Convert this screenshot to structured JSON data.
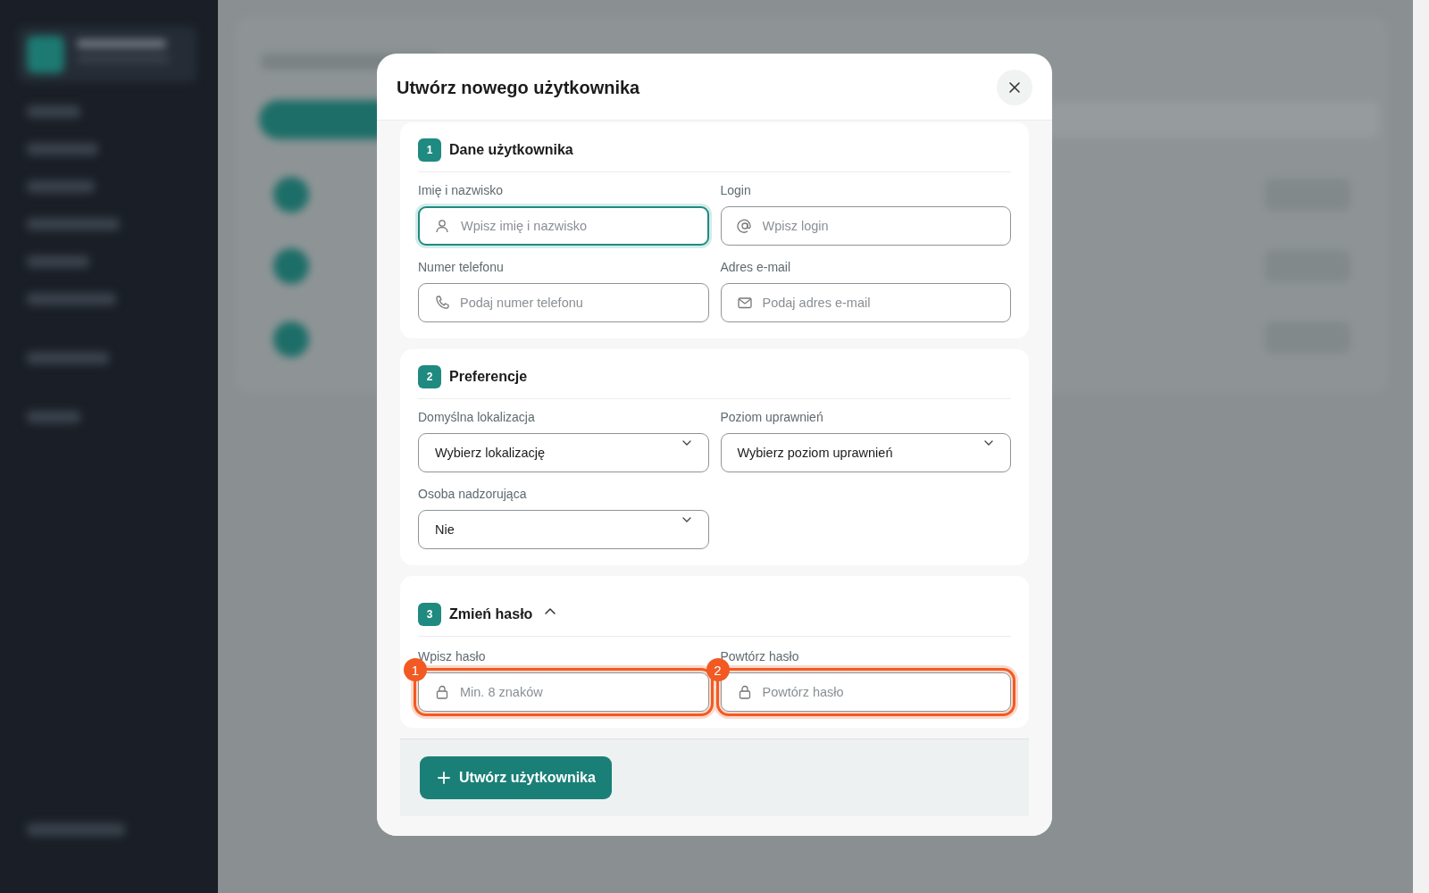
{
  "dialog": {
    "title": "Utwórz nowego użytkownika"
  },
  "sections": [
    {
      "number": "1",
      "title": "Dane użytkownika",
      "fields": [
        {
          "kind": "name",
          "label": "Imię i nazwisko",
          "placeholder": "Wpisz imię i nazwisko",
          "focused": true,
          "highlighted": false
        },
        {
          "kind": "login",
          "label": "Login",
          "placeholder": "Wpisz login",
          "focused": false,
          "highlighted": false
        },
        {
          "kind": "tel",
          "label": "Numer telefonu",
          "placeholder": "Podaj numer telefonu",
          "focused": false,
          "highlighted": false
        },
        {
          "kind": "email",
          "label": "Adres e-mail",
          "placeholder": "Podaj adres e-mail",
          "focused": false,
          "highlighted": false
        }
      ]
    },
    {
      "number": "2",
      "title": "Preferencje",
      "fields": [
        {
          "kind": "select",
          "label": "Domyślna lokalizacja",
          "value": "Wybierz lokalizację",
          "focused": false,
          "highlighted": false
        },
        {
          "kind": "select",
          "label": "Poziom uprawnień",
          "value": "Wybierz poziom uprawnień",
          "focused": false,
          "highlighted": false
        },
        {
          "kind": "select",
          "label": "Osoba nadzorująca",
          "value": "Nie",
          "focused": false,
          "highlighted": false
        }
      ]
    },
    {
      "number": "3",
      "title": "Zmień hasło",
      "expanded": true,
      "fields": [
        {
          "kind": "password",
          "label": "Wpisz hasło",
          "placeholder": "Min. 8 znaków",
          "focused": false,
          "highlighted": true,
          "marker": "1"
        },
        {
          "kind": "password",
          "label": "Powtórz hasło",
          "placeholder": "Powtórz hasło",
          "focused": false,
          "highlighted": true,
          "marker": "2"
        }
      ]
    }
  ],
  "submit_button": {
    "label": "Utwórz użytkownika"
  }
}
